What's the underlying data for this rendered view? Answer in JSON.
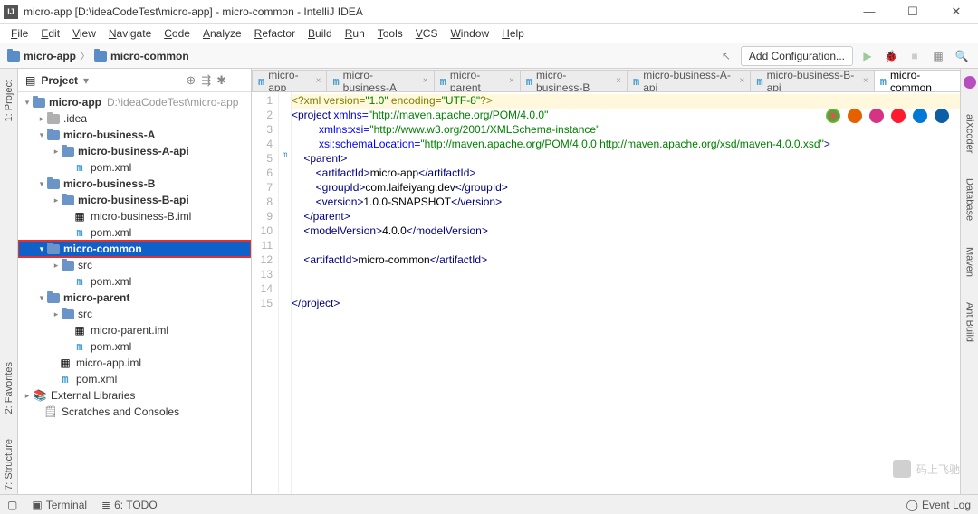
{
  "window": {
    "title": "micro-app [D:\\ideaCodeTest\\micro-app] - micro-common - IntelliJ IDEA"
  },
  "menu": [
    "File",
    "Edit",
    "View",
    "Navigate",
    "Code",
    "Analyze",
    "Refactor",
    "Build",
    "Run",
    "Tools",
    "VCS",
    "Window",
    "Help"
  ],
  "breadcrumb": {
    "root": "micro-app",
    "current": "micro-common"
  },
  "toolbar": {
    "addConfig": "Add Configuration..."
  },
  "project": {
    "title": "Project",
    "root": "micro-app",
    "rootPath": "D:\\ideaCodeTest\\micro-app",
    "idea": ".idea",
    "mba": "micro-business-A",
    "mbaApi": "micro-business-A-api",
    "mbaPom": "pom.xml",
    "mbb": "micro-business-B",
    "mbbApi": "micro-business-B-api",
    "mbbIml": "micro-business-B.iml",
    "mbbPom": "pom.xml",
    "mc": "micro-common",
    "mcSrc": "src",
    "mcPom": "pom.xml",
    "mp": "micro-parent",
    "mpSrc": "src",
    "mpIml": "micro-parent.iml",
    "mpPom": "pom.xml",
    "appIml": "micro-app.iml",
    "appPom": "pom.xml",
    "ext": "External Libraries",
    "scr": "Scratches and Consoles"
  },
  "tabs": [
    "micro-app",
    "micro-business-A",
    "micro-parent",
    "micro-business-B",
    "micro-business-A-api",
    "micro-business-B-api",
    "micro-common"
  ],
  "gutterLeft": [
    "1: Project",
    "2: Favorites",
    "7: Structure"
  ],
  "gutterRight": [
    "aiXcoder",
    "Database",
    "Maven",
    "Ant Build"
  ],
  "status": {
    "terminal": "Terminal",
    "todo": "6: TODO",
    "eventLog": "Event Log"
  },
  "watermark": "码上飞驰",
  "chart_data": {
    "type": "xml",
    "lines": [
      {
        "n": 1,
        "hl": true,
        "parts": [
          [
            "pi",
            "<?xml version="
          ],
          [
            "str",
            "\"1.0\""
          ],
          [
            "pi",
            " encoding="
          ],
          [
            "str",
            "\"UTF-8\""
          ],
          [
            "pi",
            "?>"
          ]
        ]
      },
      {
        "n": 2,
        "parts": [
          [
            "tag",
            "<project "
          ],
          [
            "attr",
            "xmlns="
          ],
          [
            "str",
            "\"http://maven.apache.org/POM/4.0.0\""
          ]
        ]
      },
      {
        "n": 3,
        "parts": [
          [
            "txt",
            "         "
          ],
          [
            "attr",
            "xmlns:xsi="
          ],
          [
            "str",
            "\"http://www.w3.org/2001/XMLSchema-instance\""
          ]
        ]
      },
      {
        "n": 4,
        "parts": [
          [
            "txt",
            "         "
          ],
          [
            "attr",
            "xsi:schemaLocation="
          ],
          [
            "str",
            "\"http://maven.apache.org/POM/4.0.0 http://maven.apache.org/xsd/maven-4.0.0.xsd\""
          ],
          [
            "tag",
            ">"
          ]
        ]
      },
      {
        "n": 5,
        "mark": "m",
        "parts": [
          [
            "txt",
            "    "
          ],
          [
            "tag",
            "<parent>"
          ]
        ]
      },
      {
        "n": 6,
        "parts": [
          [
            "txt",
            "        "
          ],
          [
            "tag",
            "<artifactId>"
          ],
          [
            "txt",
            "micro-app"
          ],
          [
            "tag",
            "</artifactId>"
          ]
        ]
      },
      {
        "n": 7,
        "parts": [
          [
            "txt",
            "        "
          ],
          [
            "tag",
            "<groupId>"
          ],
          [
            "txt",
            "com.laifeiyang.dev"
          ],
          [
            "tag",
            "</groupId>"
          ]
        ]
      },
      {
        "n": 8,
        "parts": [
          [
            "txt",
            "        "
          ],
          [
            "tag",
            "<version>"
          ],
          [
            "txt",
            "1.0.0-SNAPSHOT"
          ],
          [
            "tag",
            "</version>"
          ]
        ]
      },
      {
        "n": 9,
        "parts": [
          [
            "txt",
            "    "
          ],
          [
            "tag",
            "</parent>"
          ]
        ]
      },
      {
        "n": 10,
        "parts": [
          [
            "txt",
            "    "
          ],
          [
            "tag",
            "<modelVersion>"
          ],
          [
            "txt",
            "4.0.0"
          ],
          [
            "tag",
            "</modelVersion>"
          ]
        ]
      },
      {
        "n": 11,
        "parts": []
      },
      {
        "n": 12,
        "parts": [
          [
            "txt",
            "    "
          ],
          [
            "tag",
            "<artifactId>"
          ],
          [
            "txt",
            "micro-common"
          ],
          [
            "tag",
            "</artifactId>"
          ]
        ]
      },
      {
        "n": 13,
        "parts": []
      },
      {
        "n": 14,
        "parts": []
      },
      {
        "n": 15,
        "parts": [
          [
            "tag",
            "</project>"
          ]
        ]
      }
    ]
  }
}
